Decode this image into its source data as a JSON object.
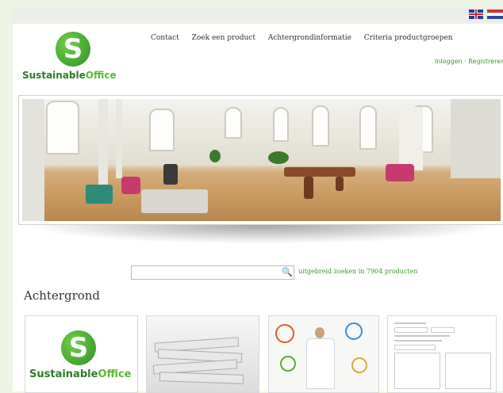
{
  "languages": [
    {
      "name": "English",
      "icon": "flag-uk-icon"
    },
    {
      "name": "Nederlands",
      "icon": "flag-nl-icon"
    }
  ],
  "logo": {
    "text_dark": "Sustainable",
    "text_light": "Office",
    "mark": "S"
  },
  "nav": [
    "Contact",
    "Zoek een product",
    "Achtergrondinformatie",
    "Criteria productgroepen"
  ],
  "login": "Inloggen · Registreren",
  "search": {
    "value": "",
    "advanced_label": "uitgebreid zoeken in 7904 producten",
    "icon": "magnifier-icon"
  },
  "section_heading": "Achtergrond",
  "colors": {
    "brand_green": "#3a9a2a",
    "brand_dark": "#2f7a2a",
    "background": "#eef4e3"
  }
}
